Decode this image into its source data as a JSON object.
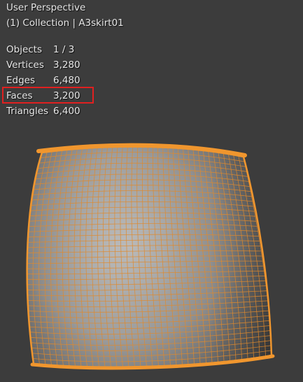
{
  "header": {
    "view_name": "User Perspective",
    "collection_line": "(1) Collection | A3skirt01"
  },
  "stats": [
    {
      "label": "Objects",
      "value": "1 / 3"
    },
    {
      "label": "Vertices",
      "value": "3,280"
    },
    {
      "label": "Edges",
      "value": "6,480"
    },
    {
      "label": "Faces",
      "value": "3,200"
    },
    {
      "label": "Triangles",
      "value": "6,400"
    }
  ],
  "colors": {
    "background": "#3c3c3c",
    "selection_outline": "#f0962e",
    "wire": "#e08a2c",
    "highlight": "#e02020"
  },
  "object": {
    "name": "A3skirt01",
    "selected": true
  }
}
